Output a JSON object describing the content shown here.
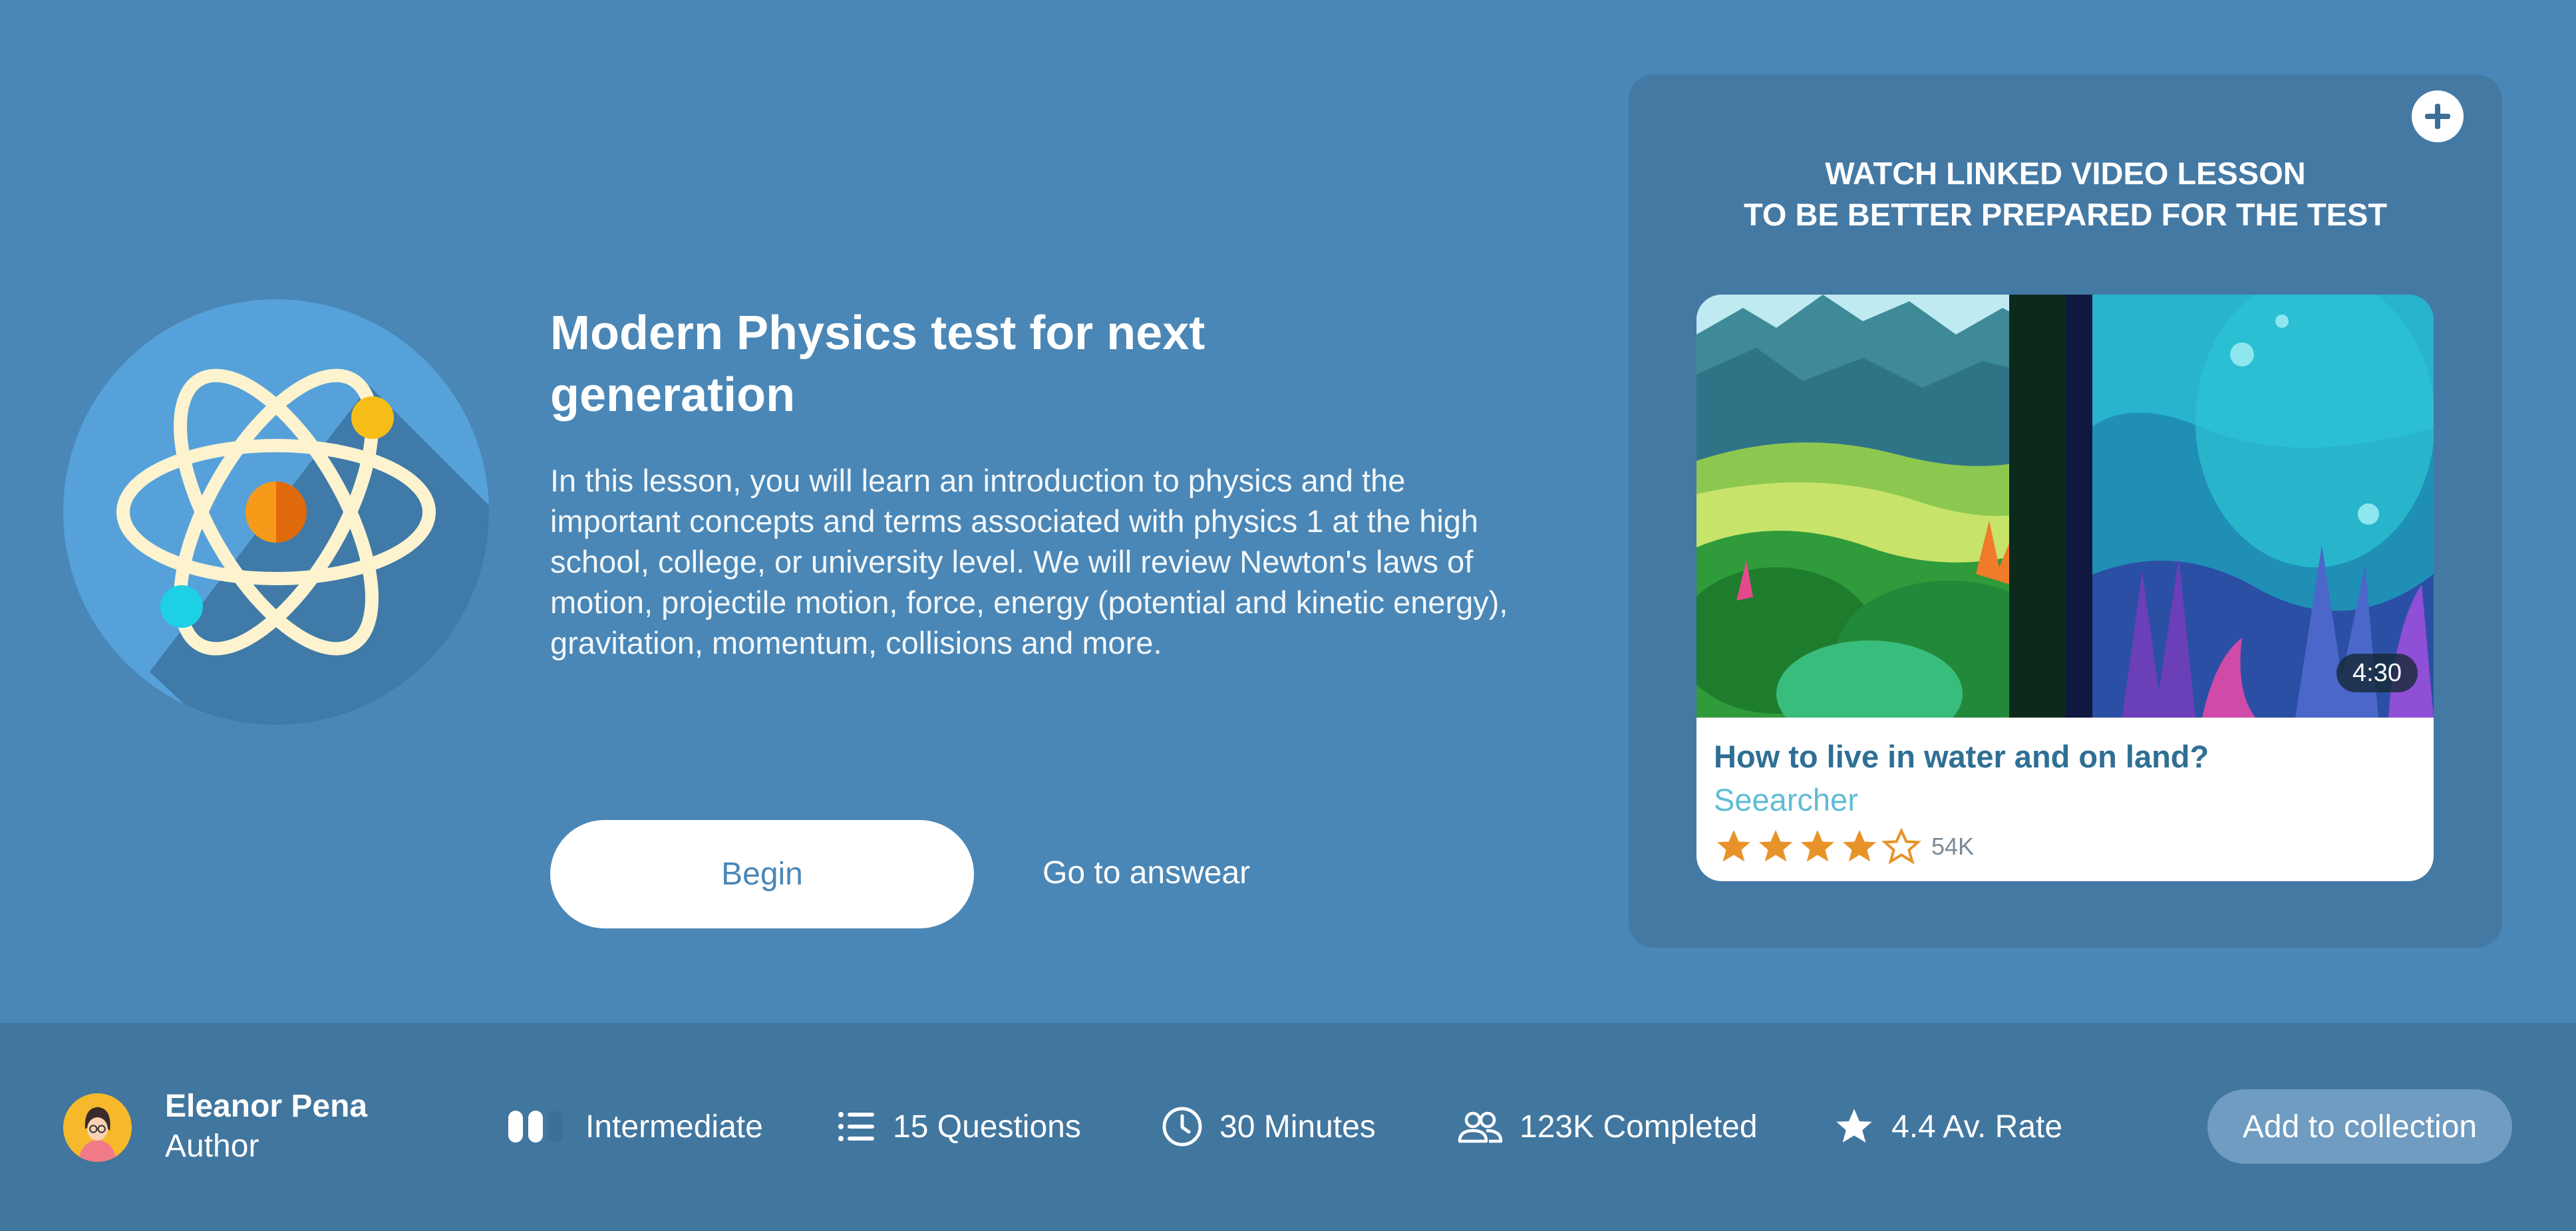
{
  "lesson": {
    "title": "Modern Physics test for next generation",
    "description": "In this lesson, you will learn an introduction to physics and the important concepts and terms associated with physics 1 at the high school, college, or university level. We will review Newton's laws of motion, projectile motion, force, energy (potential and kinetic energy), gravitation, momentum, collisions and more.",
    "icon": "atom-icon"
  },
  "actions": {
    "begin_label": "Begin",
    "answer_label": "Go to answear"
  },
  "video_panel": {
    "heading_line1": "WATCH LINKED VIDEO LESSON",
    "heading_line2": "TO BE BETTER PREPARED FOR THE TEST",
    "add_icon": "plus-icon",
    "video": {
      "title": "How to live in water and on land?",
      "author": "Seearcher",
      "duration": "4:30",
      "rating_stars": 4,
      "rating_max": 5,
      "rating_count": "54K"
    }
  },
  "footer": {
    "author": {
      "name": "Eleanor Pena",
      "role": "Author"
    },
    "level": {
      "label": "Intermediate",
      "icon": "level-bars-icon",
      "filled_bars": 2,
      "total_bars": 3
    },
    "questions": {
      "label": "15 Questions",
      "icon": "list-icon"
    },
    "duration": {
      "label": "30 Minutes",
      "icon": "clock-icon"
    },
    "completed": {
      "label": "123K Completed",
      "icon": "users-icon"
    },
    "rate": {
      "label": "4.4 Av. Rate",
      "icon": "star-icon"
    },
    "collection_label": "Add to collection"
  },
  "colors": {
    "background": "#4a87b6",
    "panel": "#4479a4",
    "footer": "#41769f",
    "accent_star": "#e8932a",
    "video_title": "#2f6f94",
    "video_author": "#5fbcd6"
  }
}
